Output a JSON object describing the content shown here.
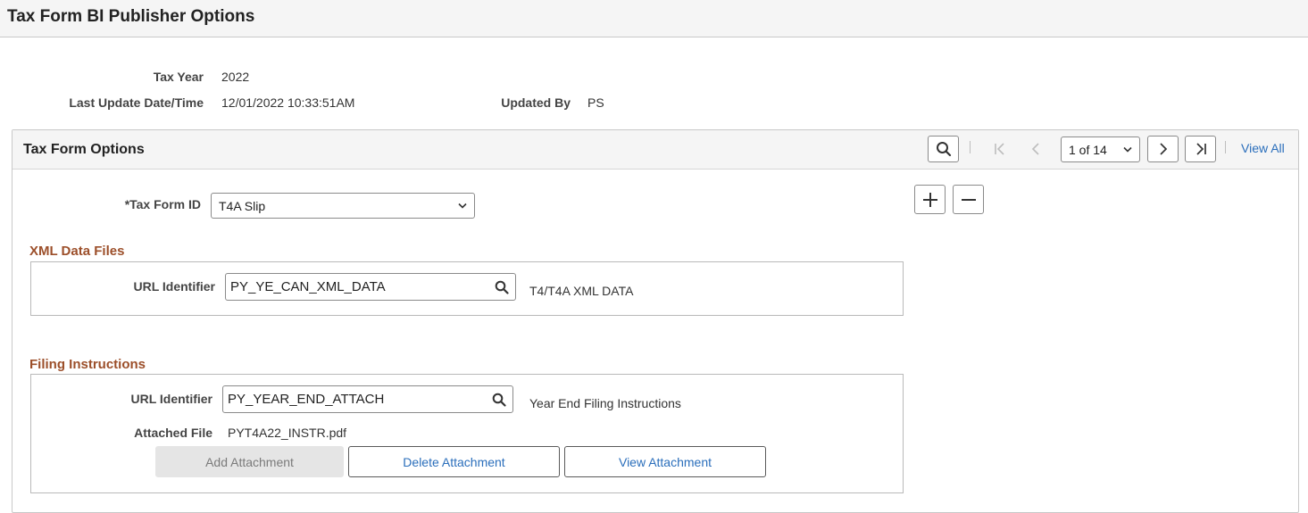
{
  "page": {
    "title": "Tax Form BI Publisher Options"
  },
  "header_fields": {
    "tax_year_label": "Tax Year",
    "tax_year_value": "2022",
    "last_update_label": "Last Update Date/Time",
    "last_update_value": "12/01/2022 10:33:51AM",
    "updated_by_label": "Updated By",
    "updated_by_value": "PS"
  },
  "tax_form_options": {
    "title": "Tax Form Options",
    "pager": {
      "selected": "1 of 14",
      "view_all": "View All"
    },
    "tax_form_id_label": "*Tax Form ID",
    "tax_form_id_value": "T4A Slip"
  },
  "xml_data_files": {
    "title": "XML Data Files",
    "url_identifier_label": "URL Identifier",
    "url_identifier_value": "PY_YE_CAN_XML_DATA",
    "url_description": "T4/T4A XML DATA"
  },
  "filing_instructions": {
    "title": "Filing Instructions",
    "url_identifier_label": "URL Identifier",
    "url_identifier_value": "PY_YEAR_END_ATTACH",
    "url_description": "Year End Filing Instructions",
    "attached_file_label": "Attached File",
    "attached_file_value": "PYT4A22_INSTR.pdf",
    "buttons": {
      "add": "Add Attachment",
      "delete": "Delete Attachment",
      "view": "View Attachment"
    }
  },
  "icons": {
    "search": "magnifier-icon",
    "first": "first-page-icon",
    "prev": "previous-icon",
    "next": "next-icon",
    "last": "last-page-icon",
    "add_row": "plus-icon",
    "delete_row": "minus-icon",
    "dropdown": "chevron-down-icon"
  },
  "colors": {
    "section_title": "#9c4f2a",
    "link": "#2a6ebb"
  }
}
